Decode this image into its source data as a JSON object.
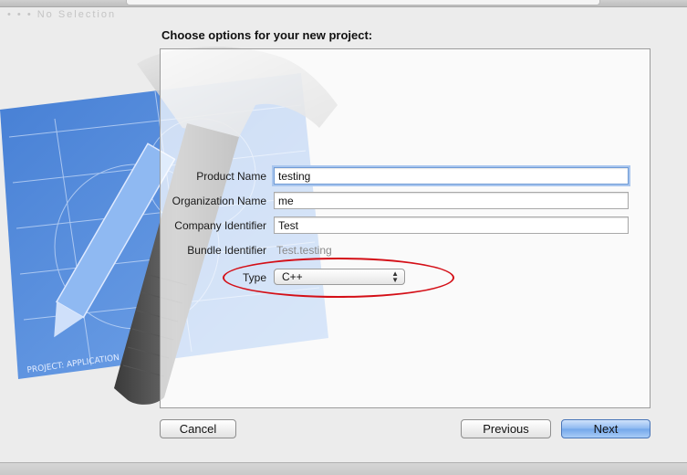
{
  "window": {
    "faint_title": "• • •    No Selection"
  },
  "dialog": {
    "heading": "Choose options for your new project:"
  },
  "form": {
    "product_name": {
      "label": "Product Name",
      "value": "testing"
    },
    "organization_name": {
      "label": "Organization Name",
      "value": "me"
    },
    "company_identifier": {
      "label": "Company Identifier",
      "value": "Test"
    },
    "bundle_identifier": {
      "label": "Bundle Identifier",
      "value": "Test.testing"
    },
    "type": {
      "label": "Type",
      "selected": "C++"
    }
  },
  "artwork": {
    "text_line_1": "PROJECT:  APPLICATION . APP",
    "icon": "xcode-hammer-blueprint-icon"
  },
  "buttons": {
    "cancel": "Cancel",
    "previous": "Previous",
    "next": "Next"
  },
  "colors": {
    "highlight_ellipse": "#d40f17",
    "focus_ring": "#a9c6ee",
    "primary_button": "#73a6ea",
    "blueprint": "#4f86d9"
  }
}
